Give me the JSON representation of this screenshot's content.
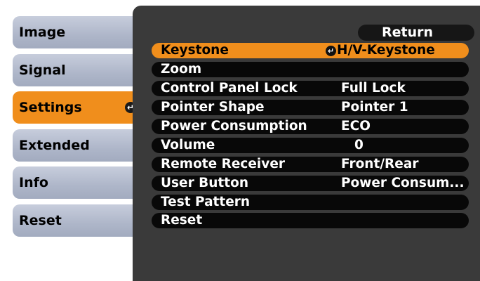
{
  "tabs": [
    {
      "label": "Image"
    },
    {
      "label": "Signal"
    },
    {
      "label": "Settings",
      "enter_glyph": "↵"
    },
    {
      "label": "Extended"
    },
    {
      "label": "Info"
    },
    {
      "label": "Reset"
    }
  ],
  "return_label": "Return",
  "menu": [
    {
      "label": "Keystone",
      "value": "H/V-Keystone",
      "enter_glyph": "↵"
    },
    {
      "label": "Zoom",
      "value": ""
    },
    {
      "label": "Control Panel Lock",
      "value": "Full Lock"
    },
    {
      "label": "Pointer Shape",
      "value": "Pointer 1"
    },
    {
      "label": "Power Consumption",
      "value": "ECO"
    },
    {
      "label": "Volume",
      "value": "0"
    },
    {
      "label": "Remote Receiver",
      "value": "Front/Rear"
    },
    {
      "label": "User Button",
      "value": "Power Consum..."
    },
    {
      "label": "Test Pattern",
      "value": ""
    },
    {
      "label": "Reset",
      "value": ""
    }
  ],
  "colors": {
    "accent": "#f08e1c",
    "panel": "#3a3a3a",
    "row": "#080808",
    "tab": "#aeb6c9"
  },
  "icons": {
    "enter": "enter-icon"
  }
}
